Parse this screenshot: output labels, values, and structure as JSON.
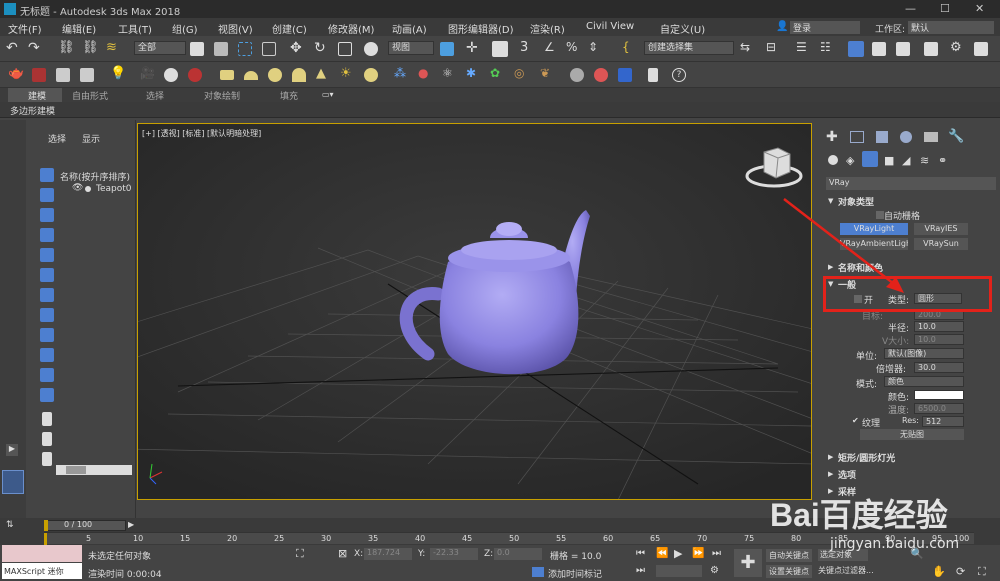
{
  "title": "无标题 - Autodesk 3ds Max 2018",
  "menu": [
    "文件(F)",
    "编辑(E)",
    "工具(T)",
    "组(G)",
    "视图(V)",
    "创建(C)",
    "修改器(M)",
    "动画(A)",
    "图形编辑器(D)",
    "渲染(R)",
    "Civil View",
    "自定义(U)"
  ],
  "user": {
    "login": "登录",
    "workspace_label": "工作区:",
    "workspace": "默认"
  },
  "toolbar": {
    "selection_filter": "全部",
    "view": "视图",
    "named_selection": "创建选择集"
  },
  "ribbon": {
    "tabs": [
      "建模",
      "自由形式",
      "选择",
      "对象绘制",
      "填充"
    ],
    "sub": "多边形建模"
  },
  "scene": {
    "tabs": [
      "选择",
      "显示"
    ],
    "column": "名称(按升序排序)",
    "item": "Teapot0"
  },
  "viewport": {
    "label": "[+] [透视] [标准] [默认明暗处理]"
  },
  "panel": {
    "renderer": "VRay",
    "object_type": "对象类型",
    "auto_grid": "自动栅格",
    "buttons": [
      "VRayLight",
      "VRayIES",
      "VRayAmbientLight",
      "VRaySun"
    ],
    "name_color": "名称和颜色",
    "general": "一般",
    "on_label": "开",
    "type_label": "类型:",
    "type_value": "圆形",
    "target_label": "目标:",
    "target_value": "200.0",
    "radius_label": "半径:",
    "radius_value": "10.0",
    "vsize_label": "V大小:",
    "vsize_value": "10.0",
    "units_label": "单位:",
    "units_value": "默认(图像)",
    "multiplier_label": "倍增器:",
    "multiplier_value": "30.0",
    "mode_label": "模式:",
    "mode_value": "颜色",
    "color_label": "颜色:",
    "temp_label": "温度:",
    "temp_value": "6500.0",
    "texture_label": "纹理",
    "res_label": "Res:",
    "res_value": "512",
    "no_map": "无贴图",
    "rect_disc": "矩形/圆形灯光",
    "options": "选项",
    "sampling": "采样"
  },
  "timeline": {
    "frame": "0 / 100",
    "ticks": [
      "0",
      "5",
      "10",
      "15",
      "20",
      "25",
      "30",
      "35",
      "40",
      "45",
      "50",
      "55",
      "60",
      "65",
      "70",
      "75",
      "80",
      "85",
      "90",
      "95",
      "100"
    ]
  },
  "status": {
    "maxscript": "MAXScript 迷你",
    "msg": "未选定任何对象",
    "render_time": "渲染时间 0:00:04",
    "x": "187.724",
    "y": "-22.33",
    "z": "0.0",
    "grid": "栅格 = 10.0",
    "add_time_tag": "添加时间标记",
    "auto_key": "自动关键点",
    "selected": "选定对象",
    "set_key": "设置关键点",
    "key_filters": "关键点过滤器..."
  },
  "watermark": "Bai百度经验",
  "watermark_url": "jingyan.baidu.com",
  "colors": {
    "accent": "#e3221a",
    "teapot": "#8a82e0",
    "viewport_border": "#c8a000",
    "active_blue": "#4d7fd0"
  }
}
